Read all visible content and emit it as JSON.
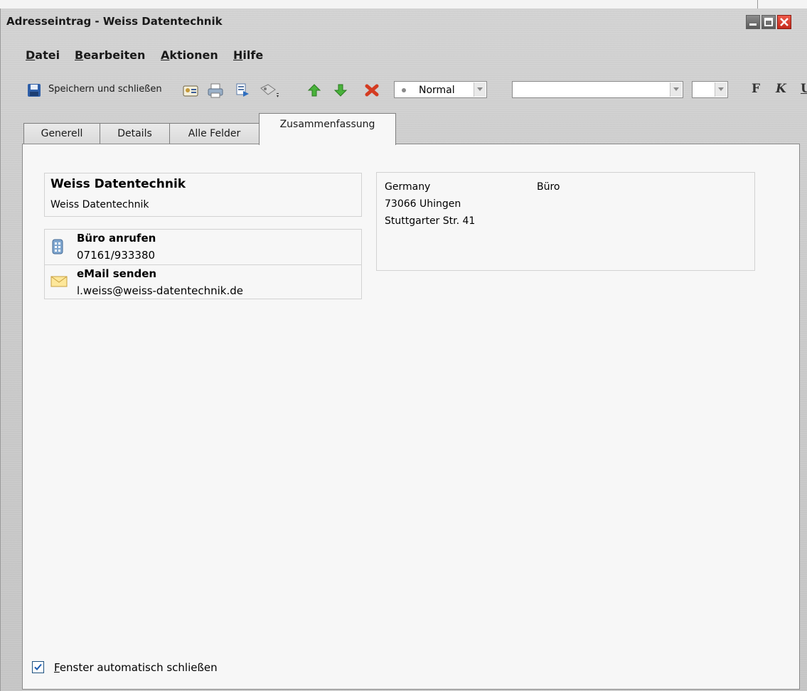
{
  "window": {
    "title": "Adresseintrag - Weiss Datentechnik",
    "accent": "#c42a1c"
  },
  "menu": {
    "items": [
      {
        "mnemonic": "D",
        "rest": "atei"
      },
      {
        "mnemonic": "B",
        "rest": "earbeiten"
      },
      {
        "mnemonic": "A",
        "rest": "ktionen"
      },
      {
        "mnemonic": "H",
        "rest": "ilfe"
      }
    ]
  },
  "toolbar": {
    "save_label": "Speichern und schließen",
    "icons": [
      "save-icon",
      "contact-card-icon",
      "print-icon",
      "send-icon",
      "tag-icon",
      "up-arrow-icon",
      "down-arrow-icon",
      "delete-icon"
    ],
    "priority_value": "Normal",
    "font_value": "",
    "size_value": "",
    "bold_label": "F",
    "italic_label": "K",
    "underline_label": "U"
  },
  "tabs": [
    {
      "label": "Generell",
      "active": false
    },
    {
      "label": "Details",
      "active": false
    },
    {
      "label": "Alle Felder",
      "active": false
    },
    {
      "label": "Zusammenfassung",
      "active": true
    }
  ],
  "summary": {
    "name_title": "Weiss Datentechnik",
    "name_sub": "Weiss Datentechnik",
    "call_label": "Büro anrufen",
    "call_value": "07161/933380",
    "mail_label": "eMail senden",
    "mail_value": "l.weiss@weiss-datentechnik.de",
    "address_lines": [
      "Germany",
      "73066 Uhingen",
      "Stuttgarter Str. 41"
    ],
    "address_type": "Büro"
  },
  "footer": {
    "auto_close_mnemonic": "F",
    "auto_close_rest": "enster automatisch schließen",
    "auto_close_checked": true
  }
}
